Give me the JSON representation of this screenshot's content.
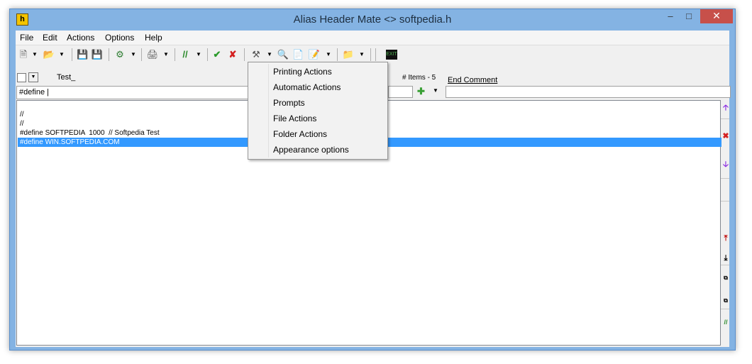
{
  "window": {
    "title": "Alias Header Mate <> softpedia.h",
    "app_icon_letter": "h",
    "controls": {
      "minimize": "–",
      "maximize": "□",
      "close": "✕"
    }
  },
  "menubar": {
    "items": [
      "File",
      "Edit",
      "Actions",
      "Options",
      "Help"
    ]
  },
  "toolbar": {
    "icons": [
      "new-file-icon",
      "open-folder-icon",
      "save-icon",
      "save-all-icon",
      "find-in-files-icon",
      "print-icon",
      "comment-icon",
      "accept-icon",
      "reject-icon",
      "tools-icon",
      "binoculars-icon",
      "document-icon",
      "properties-icon",
      "folder-binoculars-icon",
      "exit-icon"
    ]
  },
  "row2": {
    "test_label": "Test_",
    "items_count": "# Items - 5",
    "end_comment": "End Comment"
  },
  "define_input": {
    "value": "#define |"
  },
  "editor": {
    "lines": [
      "//",
      "//",
      "#define SOFTPEDIA  1000  // Softpedia Test",
      "#define WIN.SOFTPEDIA.COM"
    ],
    "selected_line": 3
  },
  "context_menu": {
    "items": [
      "Printing Actions",
      "Automatic Actions",
      "Prompts",
      "File Actions",
      "Folder Actions",
      "Appearance options"
    ]
  },
  "colors": {
    "titlebar": "#84b3e3",
    "selection": "#3399ff",
    "close_button": "#c7504a"
  }
}
